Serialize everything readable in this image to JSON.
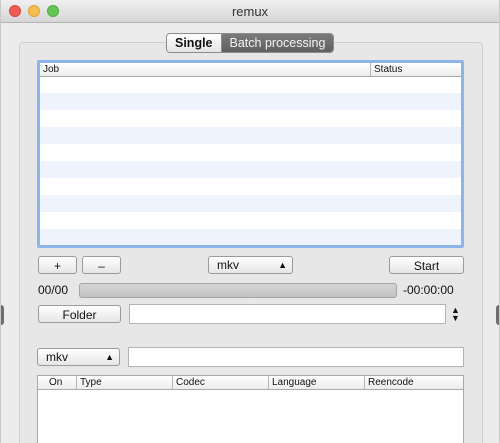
{
  "window": {
    "title": "remux"
  },
  "mode_tabs": [
    {
      "label": "Single",
      "selected": false
    },
    {
      "label": "Batch processing",
      "selected": true
    }
  ],
  "job_table": {
    "columns": [
      "Job",
      "Status"
    ],
    "rows": []
  },
  "toolbar": {
    "add_label": "+",
    "remove_label": "–",
    "format_value": "mkv",
    "start_label": "Start"
  },
  "progress": {
    "count_text": "00/00",
    "fraction": 0,
    "time_text": "-00:00:00"
  },
  "output": {
    "folder_label": "Folder",
    "folder_path": ""
  },
  "track": {
    "format_value": "mkv",
    "options_value": ""
  },
  "streams_table": {
    "columns": [
      "On",
      "Type",
      "Codec",
      "Language",
      "Reencode"
    ],
    "rows": []
  },
  "colors": {
    "selection_border": "#8db5ea",
    "row_stripe": "#eef3fd",
    "segment_selected": "#6b6b6b"
  },
  "icons": [
    "close-icon",
    "minimize-icon",
    "zoom-icon",
    "updown-arrows-icon"
  ]
}
